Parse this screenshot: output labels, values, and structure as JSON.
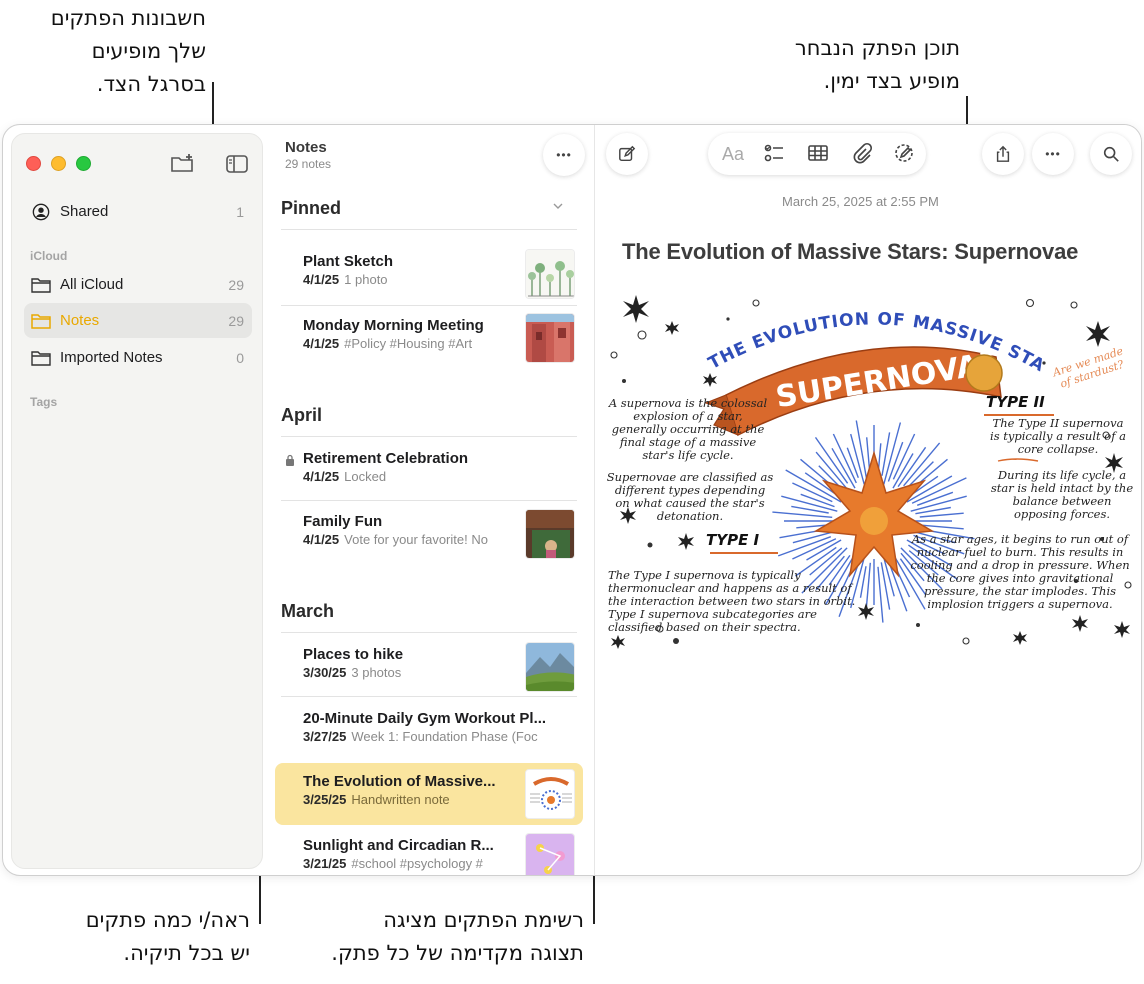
{
  "callouts": {
    "top_left": [
      "חשבונות הפתקים",
      "שלך מופיעים",
      "בסרגל הצד."
    ],
    "top_right": [
      "תוכן הפתק הנבחר",
      "מופיע בצד ימין."
    ],
    "bottom_left": [
      "ראה/י כמה פתקים",
      "יש בכל תיקיה."
    ],
    "bottom_middle": [
      "רשימת הפתקים מציגה",
      "תצוגה מקדימה של כל פתק."
    ]
  },
  "sidebar": {
    "shared": {
      "label": "Shared",
      "count": "1"
    },
    "icloud_header": "iCloud",
    "items": [
      {
        "label": "All iCloud",
        "count": "29"
      },
      {
        "label": "Notes",
        "count": "29"
      },
      {
        "label": "Imported Notes",
        "count": "0"
      }
    ],
    "tags_header": "Tags"
  },
  "list": {
    "title": "Notes",
    "subtitle": "29 notes",
    "more": "•••",
    "groups": {
      "pinned": "Pinned",
      "april": "April",
      "march": "March"
    },
    "notes": [
      {
        "title": "Plant Sketch",
        "date": "4/1/25",
        "preview": "1 photo"
      },
      {
        "title": "Monday Morning Meeting",
        "date": "4/1/25",
        "preview": "#Policy #Housing #Art"
      },
      {
        "title": "Retirement Celebration",
        "date": "4/1/25",
        "preview": "Locked"
      },
      {
        "title": "Family Fun",
        "date": "4/1/25",
        "preview": "Vote for your favorite! No"
      },
      {
        "title": "Places to hike",
        "date": "3/30/25",
        "preview": "3 photos"
      },
      {
        "title": "20-Minute Daily Gym Workout Pl...",
        "date": "3/27/25",
        "preview": "Week 1: Foundation Phase (Foc"
      },
      {
        "title": "The Evolution of Massive...",
        "date": "3/25/25",
        "preview": "Handwritten note"
      },
      {
        "title": "Sunlight and Circadian R...",
        "date": "3/21/25",
        "preview": "#school #psychology #"
      }
    ]
  },
  "detail": {
    "toolbar": {
      "format_label": "Aa",
      "more": "•••"
    },
    "timestamp": "March 25, 2025 at 2:55 PM",
    "title": "The Evolution of Massive Stars: Supernovae",
    "drawing": {
      "arc_title": "THE EVOLUTION OF MASSIVE STARS:",
      "banner": "SUPERNOVAE",
      "aside": "Are we made of stardust?",
      "type2_heading": "TYPE II",
      "type1_heading": "TYPE I",
      "p1": "A supernova is the colossal explosion of a star, generally occurring at the final stage of a massive star's life cycle.",
      "p2": "Supernovae are classified as different types depending on what caused the star's detonation.",
      "p3": "The Type II supernova is typically a result of a core collapse.",
      "p4": "During its life cycle, a star is held intact by the balance between opposing forces.",
      "p5": "As a star ages, it begins to run out of nuclear fuel to burn. This results in cooling and a drop in pressure. When the core gives into gravitational pressure, the star implodes. This implosion triggers a supernova.",
      "p6": "The Type I supernova is typically thermonuclear and happens as a result of the interaction between two stars in orbit. Type I supernova subcategories are classified based on their spectra."
    }
  },
  "colors": {
    "accent": "#e9a800",
    "selected_note": "#fae59f",
    "banner": "#d9692c"
  }
}
